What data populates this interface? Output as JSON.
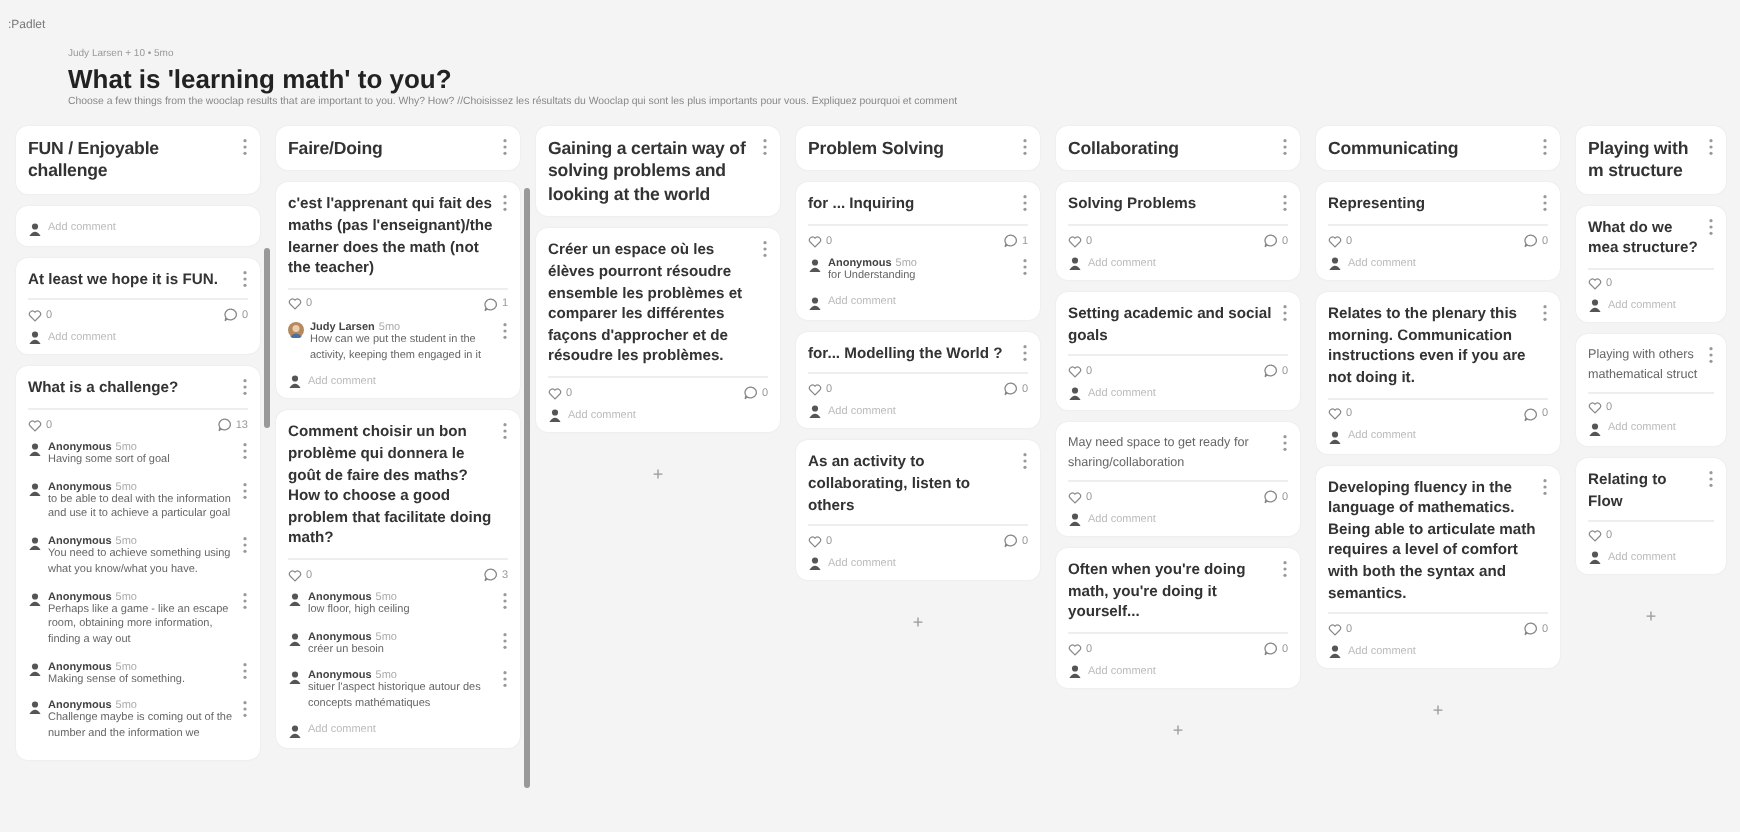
{
  "app": {
    "logo": ":Padlet"
  },
  "header": {
    "byline": "Judy Larsen + 10 • 5mo",
    "title": "What is 'learning math' to you?",
    "description": "Choose a few things from the wooclap results that are important to you. Why? How? //Choisissez les résultats du Wooclap qui sont les plus importants pour vous. Expliquez pourquoi et comment"
  },
  "columns": [
    {
      "title": "FUN / Enjoyable challenge",
      "header_comment": "Add comment",
      "posts": [
        {
          "kind": "heading",
          "text": "At least we hope it is FUN.",
          "likes": "0",
          "comments": "0",
          "add_comment": "Add comment"
        },
        {
          "kind": "heading",
          "text": "What is a challenge?",
          "likes": "0",
          "comments": "13",
          "replies": [
            {
              "kind": "anonymous",
              "author": "Anonymous",
              "time": "5mo",
              "text": "Having some sort of goal"
            },
            {
              "kind": "anonymous",
              "author": "Anonymous",
              "time": "5mo",
              "text": "to be able to deal with the information and use it to achieve a particular goal"
            },
            {
              "kind": "anonymous",
              "author": "Anonymous",
              "time": "5mo",
              "text": "You need to achieve something using what you know/what you have."
            },
            {
              "kind": "anonymous",
              "author": "Anonymous",
              "time": "5mo",
              "text": "Perhaps like a game - like an escape room, obtaining more information, finding a way out"
            },
            {
              "kind": "anonymous",
              "author": "Anonymous",
              "time": "5mo",
              "text": "Making sense of something."
            },
            {
              "kind": "anonymous",
              "author": "Anonymous",
              "time": "5mo",
              "text": "Challenge maybe is coming out of the number and the information we"
            }
          ]
        }
      ]
    },
    {
      "title": "Faire/Doing",
      "posts": [
        {
          "kind": "heading",
          "text": "c'est l'apprenant qui fait des maths (pas l'enseignant)/the learner does the math (not the teacher)",
          "likes": "0",
          "comments": "1",
          "replies": [
            {
              "kind": "photo",
              "author": "Judy Larsen",
              "time": "5mo",
              "text": "How can we put the student in the activity, keeping them engaged in it"
            }
          ],
          "add_comment": "Add comment"
        },
        {
          "kind": "heading",
          "text": "Comment choisir un bon problème qui donnera le goût de faire des maths? How to choose a good problem that facilitate doing math?",
          "likes": "0",
          "comments": "3",
          "replies": [
            {
              "kind": "anonymous",
              "author": "Anonymous",
              "time": "5mo",
              "text": "low floor, high ceiling"
            },
            {
              "kind": "anonymous",
              "author": "Anonymous",
              "time": "5mo",
              "text": "créer un besoin"
            },
            {
              "kind": "anonymous",
              "author": "Anonymous",
              "time": "5mo",
              "text": "situer l'aspect historique autour des concepts mathématiques"
            }
          ],
          "add_comment": "Add comment"
        }
      ]
    },
    {
      "title": "Gaining a certain way of solving problems and looking at the world",
      "posts": [
        {
          "kind": "heading",
          "text": "Créer un espace où les élèves pourront résoudre ensemble les problèmes et comparer les différentes façons d'approcher et de résoudre les problèmes.",
          "likes": "0",
          "comments": "0",
          "add_comment": "Add comment"
        }
      ],
      "add_post": "+"
    },
    {
      "title": "Problem Solving",
      "posts": [
        {
          "kind": "heading",
          "text": "for ... Inquiring",
          "likes": "0",
          "comments": "1",
          "replies": [
            {
              "kind": "anonymous",
              "author": "Anonymous",
              "time": "5mo",
              "text": "for Understanding"
            }
          ],
          "add_comment": "Add comment"
        },
        {
          "kind": "heading",
          "text": "for... Modelling the World ?",
          "likes": "0",
          "comments": "0",
          "add_comment": "Add comment"
        },
        {
          "kind": "heading",
          "text": "As an activity to collaborating, listen to others",
          "likes": "0",
          "comments": "0",
          "add_comment": "Add comment"
        }
      ],
      "add_post": "+"
    },
    {
      "title": "Collaborating",
      "posts": [
        {
          "kind": "heading",
          "text": "Solving Problems",
          "likes": "0",
          "comments": "0",
          "add_comment": "Add comment"
        },
        {
          "kind": "heading",
          "text": "Setting academic and social goals",
          "likes": "0",
          "comments": "0",
          "add_comment": "Add comment"
        },
        {
          "kind": "note",
          "text": "May need space to get ready for sharing/collaboration",
          "likes": "0",
          "comments": "0",
          "add_comment": "Add comment"
        },
        {
          "kind": "heading",
          "text": "Often when you're doing math, you're doing it yourself...",
          "likes": "0",
          "comments": "0",
          "add_comment": "Add comment"
        }
      ],
      "add_post": "+"
    },
    {
      "title": "Communicating",
      "posts": [
        {
          "kind": "heading",
          "text": "Representing",
          "likes": "0",
          "comments": "0",
          "add_comment": "Add comment"
        },
        {
          "kind": "heading",
          "text": "Relates to the plenary this morning. Communication instructions even if you are not doing it.",
          "likes": "0",
          "comments": "0",
          "add_comment": "Add comment"
        },
        {
          "kind": "heading",
          "text": "Developing fluency in the language of mathematics. Being able to articulate math requires a level of comfort with both the syntax and semantics.",
          "likes": "0",
          "comments": "0",
          "add_comment": "Add comment"
        }
      ],
      "add_post": "+"
    },
    {
      "title": "Playing with m structure",
      "posts": [
        {
          "kind": "heading",
          "text": "What do we mea structure?",
          "likes": "0",
          "add_comment": "Add comment"
        },
        {
          "kind": "note",
          "text": "Playing with others mathematical struct",
          "likes": "0",
          "add_comment": "Add comment"
        },
        {
          "kind": "heading",
          "text": "Relating to Flow",
          "likes": "0",
          "add_comment": "Add comment"
        }
      ],
      "add_post": "+"
    }
  ]
}
